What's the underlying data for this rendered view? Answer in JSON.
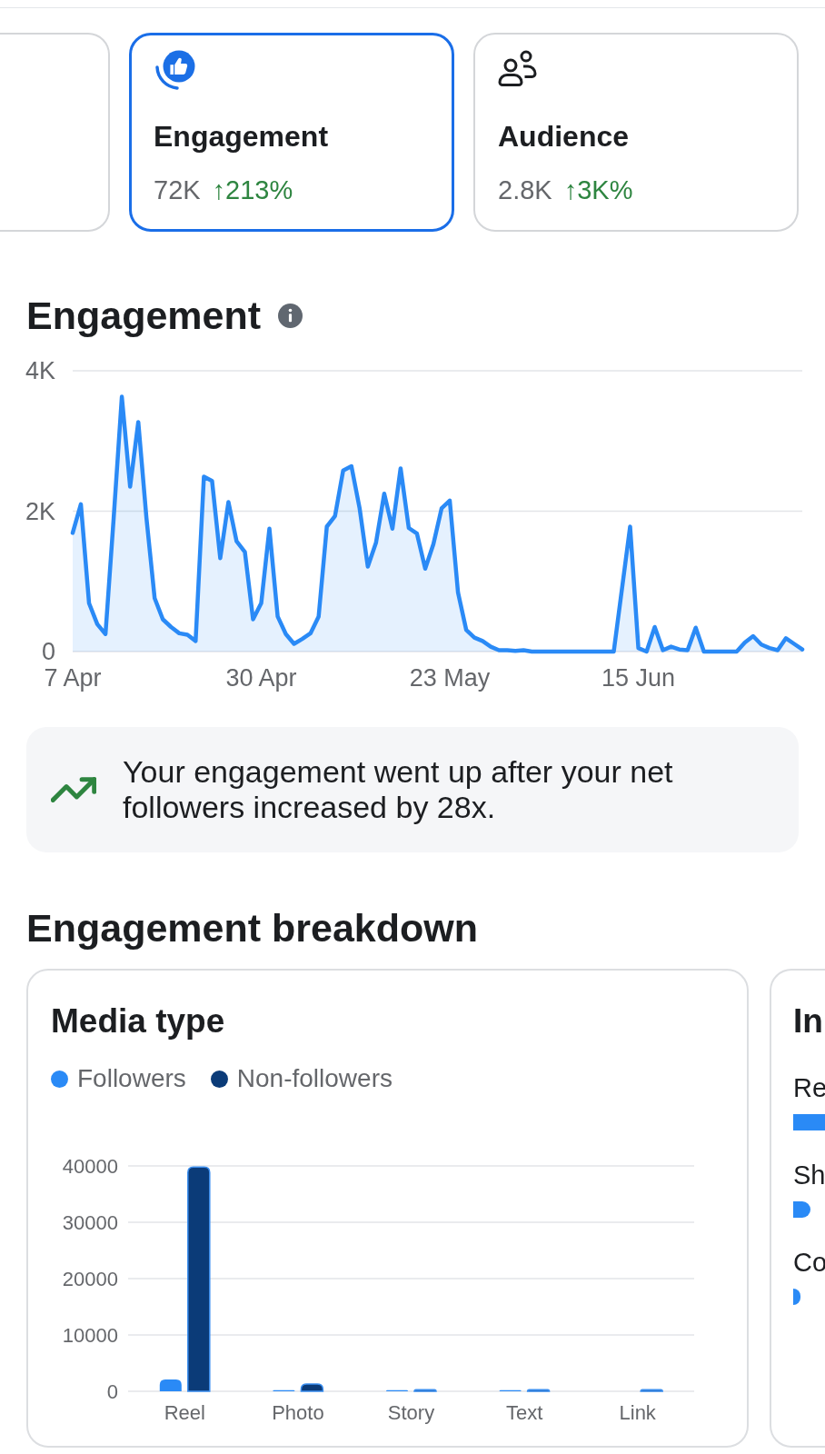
{
  "metric_cards": [
    {
      "selected": false
    },
    {
      "title": "Engagement",
      "value": "72K",
      "change": "↑213%",
      "selected": true
    },
    {
      "title": "Audience",
      "value": "2.8K",
      "change": "↑3K%",
      "selected": false
    }
  ],
  "engagement_section": {
    "title": "Engagement",
    "chart_data": {
      "type": "area",
      "categories": [
        "7 Apr",
        null,
        null,
        null,
        null,
        null,
        null,
        null,
        null,
        null,
        null,
        null,
        null,
        null,
        null,
        null,
        null,
        null,
        null,
        null,
        null,
        null,
        null,
        "30 Apr",
        null,
        null,
        null,
        null,
        null,
        null,
        null,
        null,
        null,
        null,
        null,
        null,
        null,
        null,
        null,
        null,
        null,
        null,
        null,
        null,
        null,
        null,
        "23 May",
        null,
        null,
        null,
        null,
        null,
        null,
        null,
        null,
        null,
        null,
        null,
        null,
        null,
        null,
        null,
        null,
        null,
        null,
        null,
        null,
        null,
        null,
        "15 Jun",
        null,
        null,
        null,
        null,
        null,
        null,
        null,
        null,
        null,
        null,
        null,
        null,
        null,
        null,
        null,
        null,
        null,
        null,
        null,
        null
      ],
      "ylim": [
        0,
        4000
      ],
      "yticks": [
        {
          "value": 0,
          "label": "0"
        },
        {
          "value": 2000,
          "label": "2K"
        },
        {
          "value": 4000,
          "label": "4K"
        }
      ],
      "grid": true,
      "series": [
        {
          "color": "#2a8af6",
          "values": [
            1690,
            2100,
            690,
            390,
            250,
            1900,
            3630,
            2350,
            3270,
            1900,
            760,
            460,
            350,
            260,
            240,
            150,
            2490,
            2430,
            1330,
            2130,
            1570,
            1420,
            460,
            690,
            1750,
            500,
            250,
            110,
            180,
            260,
            500,
            1780,
            1930,
            2580,
            2640,
            2040,
            1210,
            1550,
            2250,
            1750,
            2610,
            1760,
            1680,
            1180,
            1530,
            2040,
            2150,
            840,
            310,
            200,
            150,
            70,
            20,
            20,
            10,
            20,
            0,
            0,
            0,
            0,
            0,
            0,
            0,
            0,
            0,
            0,
            0,
            890,
            1780,
            50,
            0,
            350,
            20,
            70,
            30,
            20,
            340,
            0,
            0,
            0,
            0,
            0,
            130,
            220,
            100,
            50,
            20,
            190,
            110,
            30
          ]
        }
      ]
    }
  },
  "insight": {
    "text": "Your engagement went up after your net followers increased by 28x."
  },
  "breakdown": {
    "title": "Engagement breakdown",
    "media_type_card": {
      "title": "Media type",
      "chart_data": {
        "type": "bar",
        "categories": [
          "Reel",
          "Photo",
          "Story",
          "Text",
          "Link"
        ],
        "series": [
          {
            "name": "Followers",
            "color": "#2a8af6",
            "values": [
              2100,
              200,
              200,
              200,
              0
            ]
          },
          {
            "name": "Non-followers",
            "color": "#0b3b78",
            "values": [
              39800,
              1300,
              300,
              300,
              300
            ]
          }
        ],
        "ylim": [
          0,
          40000
        ],
        "yticks": [
          0,
          10000,
          20000,
          30000,
          40000
        ],
        "grid": true
      }
    },
    "next_card": {
      "title": "In",
      "items": [
        {
          "label": "Re"
        },
        {
          "label": "Sh"
        },
        {
          "label": "Co"
        }
      ]
    }
  }
}
